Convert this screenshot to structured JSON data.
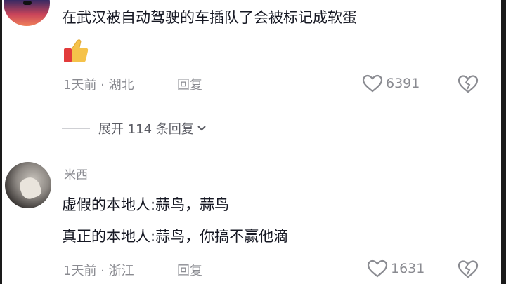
{
  "comments": [
    {
      "text": "在武汉被自动驾驶的车插队了会被标记成软蛋",
      "emoji": "thumbs-up",
      "meta": "1天前 · 湖北",
      "reply_label": "回复",
      "likes": "6391",
      "expand_label": "展开 114 条回复"
    },
    {
      "username": "米西",
      "lines": [
        "虚假的本地人:蒜鸟，蒜鸟",
        "真正的本地人:蒜鸟，你搞不赢他滴"
      ],
      "meta": "1天前 · 浙江",
      "reply_label": "回复",
      "likes": "1631"
    }
  ],
  "icons": {
    "like": "heart-outline-icon",
    "dislike": "broken-heart-icon",
    "expand": "chevron-down-icon",
    "emoji": "thumbs-up-emoji"
  }
}
